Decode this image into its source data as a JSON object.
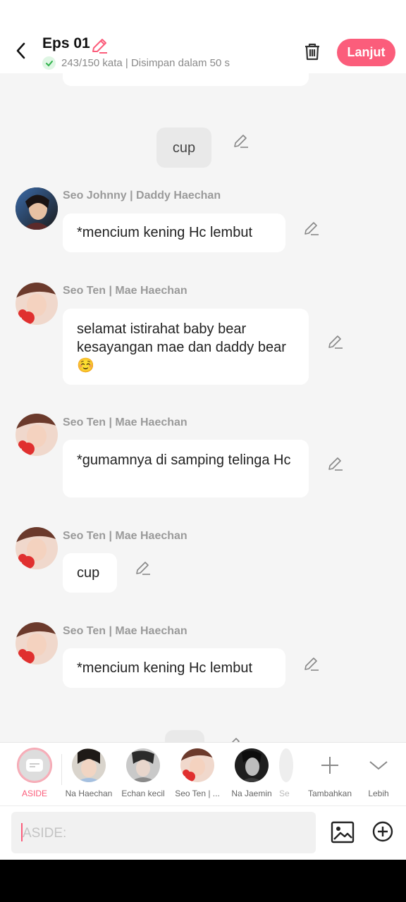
{
  "header": {
    "title": "Eps 01",
    "word_count": "243/150 kata | Disimpan dalam 50 s",
    "next_label": "Lanjut",
    "accent_color": "#fb5d7b"
  },
  "messages": [
    {
      "type": "aside",
      "text": "cup"
    },
    {
      "sender": "Seo Johnny | Daddy Haechan",
      "text": "*mencium kening Hc lembut"
    },
    {
      "sender": "Seo Ten | Mae Haechan",
      "text": "selamat istirahat baby bear kesayangan mae dan daddy bear ☺️"
    },
    {
      "sender": "Seo Ten | Mae Haechan",
      "text": "*gumamnya di samping telinga Hc"
    },
    {
      "sender": "Seo Ten | Mae Haechan",
      "text": "cup"
    },
    {
      "sender": "Seo Ten | Mae Haechan",
      "text": "*mencium kening Hc lembut"
    }
  ],
  "characters": [
    {
      "label": "ASIDE"
    },
    {
      "label": "Na Haechan"
    },
    {
      "label": "Echan kecil"
    },
    {
      "label": "Seo Ten | ..."
    },
    {
      "label": "Na Jaemin"
    },
    {
      "label": "Se"
    }
  ],
  "actions": {
    "add_label": "Tambahkan",
    "more_label": "Lebih"
  },
  "input": {
    "placeholder": "ASIDE:"
  }
}
